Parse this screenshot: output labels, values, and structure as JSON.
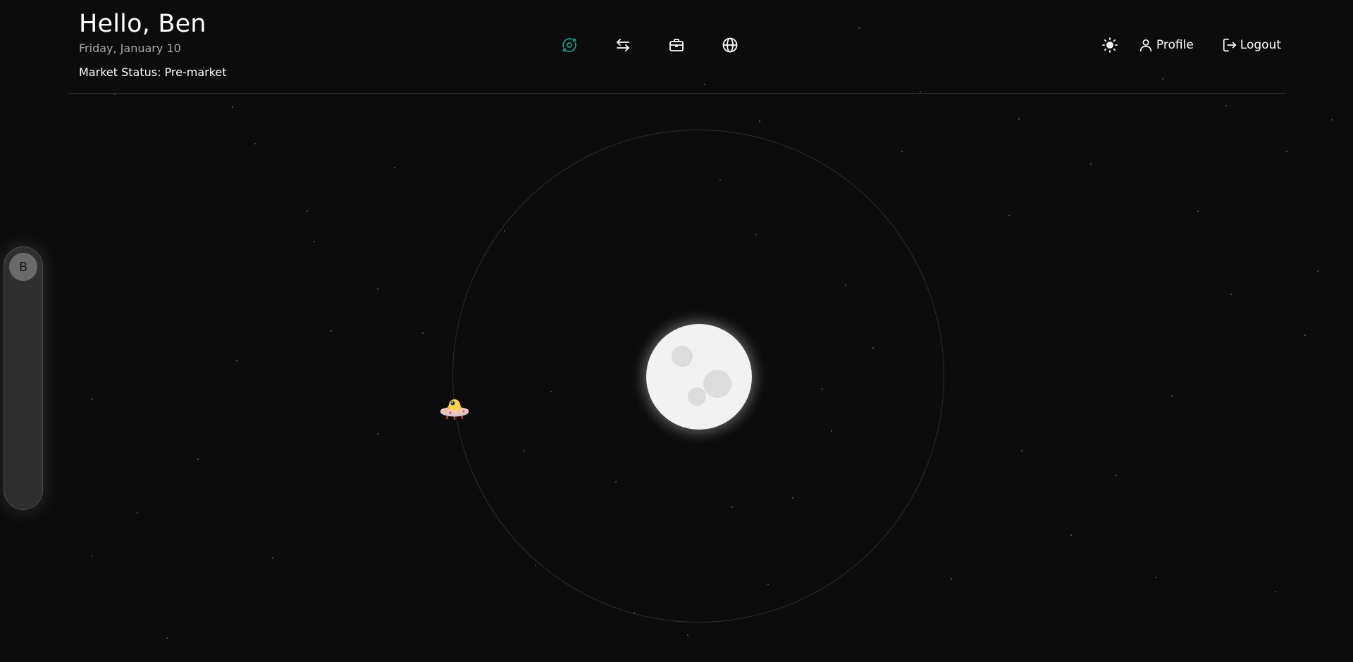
{
  "header": {
    "greeting": "Hello, Ben",
    "date": "Friday, January 10",
    "market_status": "Market Status: Pre-market"
  },
  "nav": {
    "items": [
      {
        "icon": "orbit-icon",
        "active": true
      },
      {
        "icon": "transfer-arrows-icon",
        "active": false
      },
      {
        "icon": "briefcase-icon",
        "active": false
      },
      {
        "icon": "globe-icon",
        "active": false
      }
    ],
    "active_color": "#16a085"
  },
  "user_menu": {
    "theme_icon": "sun-icon",
    "profile_label": "Profile",
    "logout_label": "Logout"
  },
  "sidebar": {
    "avatar_initial": "B"
  },
  "scene": {
    "moon_icon": "moon-icon",
    "ship_icon": "ufo-icon"
  }
}
